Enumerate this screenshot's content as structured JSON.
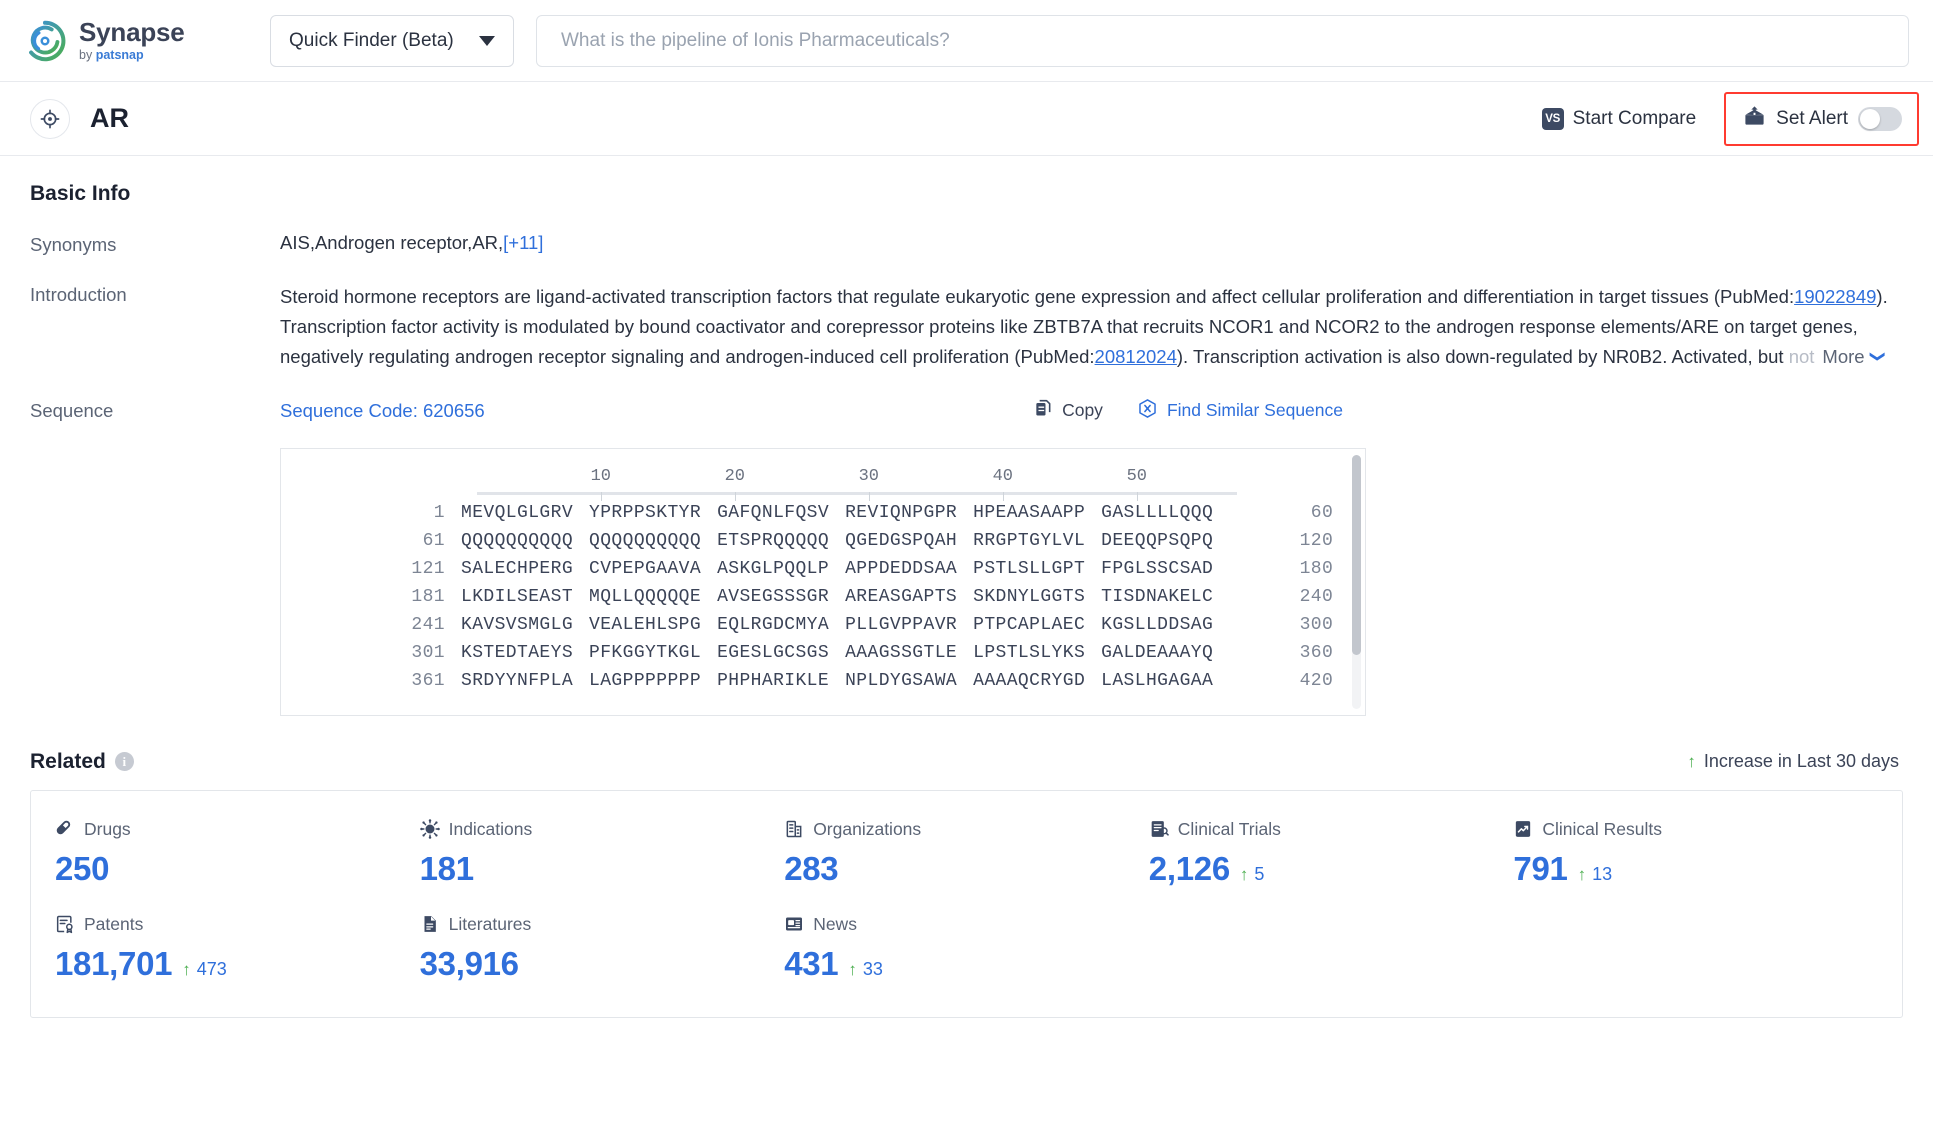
{
  "brand": {
    "name": "Synapse",
    "by": "by ",
    "by_brand": "patsnap",
    "logo_icon": "synapse-circular-logo"
  },
  "search": {
    "mode_label": "Quick Finder (Beta)",
    "mode_caret_icon": "chevron-down-icon",
    "placeholder": "What is the pipeline of Ionis Pharmaceuticals?",
    "value": ""
  },
  "titlebar": {
    "target_icon": "target-crosshair-icon",
    "entity": "AR",
    "start_compare": "Start Compare",
    "vs_icon_text": "VS",
    "set_alert": "Set Alert",
    "alert_icon": "alert-mailbox-icon",
    "toggle_state": "off",
    "highlight_color": "#ff3b30"
  },
  "basic_info": {
    "title": "Basic Info",
    "synonyms": {
      "label": "Synonyms",
      "value": "AIS,Androgen receptor,AR,",
      "more_count": "[+11]"
    },
    "introduction": {
      "label": "Introduction",
      "part1": "Steroid hormone receptors are ligand-activated transcription factors that regulate eukaryotic gene expression and affect cellular proliferation and differentiation in target tissues (PubMed:",
      "pubmed1": "19022849",
      "part2": "). Transcription factor activity is modulated by bound coactivator and corepressor proteins like ZBTB7A that recruits NCOR1 and NCOR2 to the androgen response elements/ARE on target genes, negatively regulating androgen receptor signaling and androgen-induced cell proliferation (PubMed:",
      "pubmed2": "20812024",
      "part3": "). Transcription activation is also down-regulated by NR0B2. Activated, but ",
      "faded": "not",
      "more_label": "More",
      "more_icon": "chevron-double-down-icon"
    },
    "sequence": {
      "label": "Sequence",
      "code_label": "Sequence Code: 620656",
      "copy_label": "Copy",
      "copy_icon": "copy-icon",
      "find_similar_label": "Find Similar Sequence",
      "find_similar_icon": "find-similar-sequence-icon",
      "ruler": [
        "10",
        "20",
        "30",
        "40",
        "50"
      ],
      "rows": [
        {
          "start": "1",
          "chunks": [
            "MEVQLGLGRV",
            "YPRPPSKTYR",
            "GAFQNLFQSV",
            "REVIQNPGPR",
            "HPEAASAAPP",
            "GASLLLLQQQ"
          ],
          "end": "60"
        },
        {
          "start": "61",
          "chunks": [
            "QQQQQQQQQQ",
            "QQQQQQQQQQ",
            "ETSPRQQQQQ",
            "QGEDGSPQAH",
            "RRGPTGYLVL",
            "DEEQQPSQPQ"
          ],
          "end": "120"
        },
        {
          "start": "121",
          "chunks": [
            "SALECHPERG",
            "CVPEPGAAVA",
            "ASKGLPQQLP",
            "APPDEDDSAA",
            "PSTLSLLGPT",
            "FPGLSSCSAD"
          ],
          "end": "180"
        },
        {
          "start": "181",
          "chunks": [
            "LKDILSEAST",
            "MQLLQQQQQE",
            "AVSEGSSSGR",
            "AREASGAPTS",
            "SKDNYLGGTS",
            "TISDNAKELC"
          ],
          "end": "240"
        },
        {
          "start": "241",
          "chunks": [
            "KAVSVSMGLG",
            "VEALEHLSPG",
            "EQLRGDCMYA",
            "PLLGVPPAVR",
            "PTPCAPLAEC",
            "KGSLLDDSAG"
          ],
          "end": "300"
        },
        {
          "start": "301",
          "chunks": [
            "KSTEDTAEYS",
            "PFKGGYTKGL",
            "EGESLGCSGS",
            "AAAGSSGTLE",
            "LPSTLSLYKS",
            "GALDEAAAYQ"
          ],
          "end": "360"
        },
        {
          "start": "361",
          "chunks": [
            "SRDYYNFPLA",
            "LAGPPPPPPP",
            "PHPHARIKLE",
            "NPLDYGSAWA",
            "AAAAQCRYGD",
            "LASLHGAGAA"
          ],
          "end": "420"
        }
      ]
    }
  },
  "related": {
    "title": "Related",
    "info_icon": "info-icon",
    "legend_label": "Increase in Last 30 days",
    "legend_icon": "up-arrow-icon",
    "stats": [
      {
        "label": "Drugs",
        "icon": "pill-icon",
        "value": "250",
        "delta": ""
      },
      {
        "label": "Indications",
        "icon": "virus-icon",
        "value": "181",
        "delta": ""
      },
      {
        "label": "Organizations",
        "icon": "building-icon",
        "value": "283",
        "delta": ""
      },
      {
        "label": "Clinical Trials",
        "icon": "clinical-trial-icon",
        "value": "2,126",
        "delta": "5"
      },
      {
        "label": "Clinical Results",
        "icon": "clinical-results-icon",
        "value": "791",
        "delta": "13"
      },
      {
        "label": "Patents",
        "icon": "patent-icon",
        "value": "181,701",
        "delta": "473"
      },
      {
        "label": "Literatures",
        "icon": "literature-icon",
        "value": "33,916",
        "delta": ""
      },
      {
        "label": "News",
        "icon": "news-icon",
        "value": "431",
        "delta": "33"
      }
    ]
  },
  "colors": {
    "accent_blue": "#2f6fdb",
    "green": "#4caf50",
    "alert_red": "#ff3b30",
    "icon_navy": "#3d4a63"
  }
}
